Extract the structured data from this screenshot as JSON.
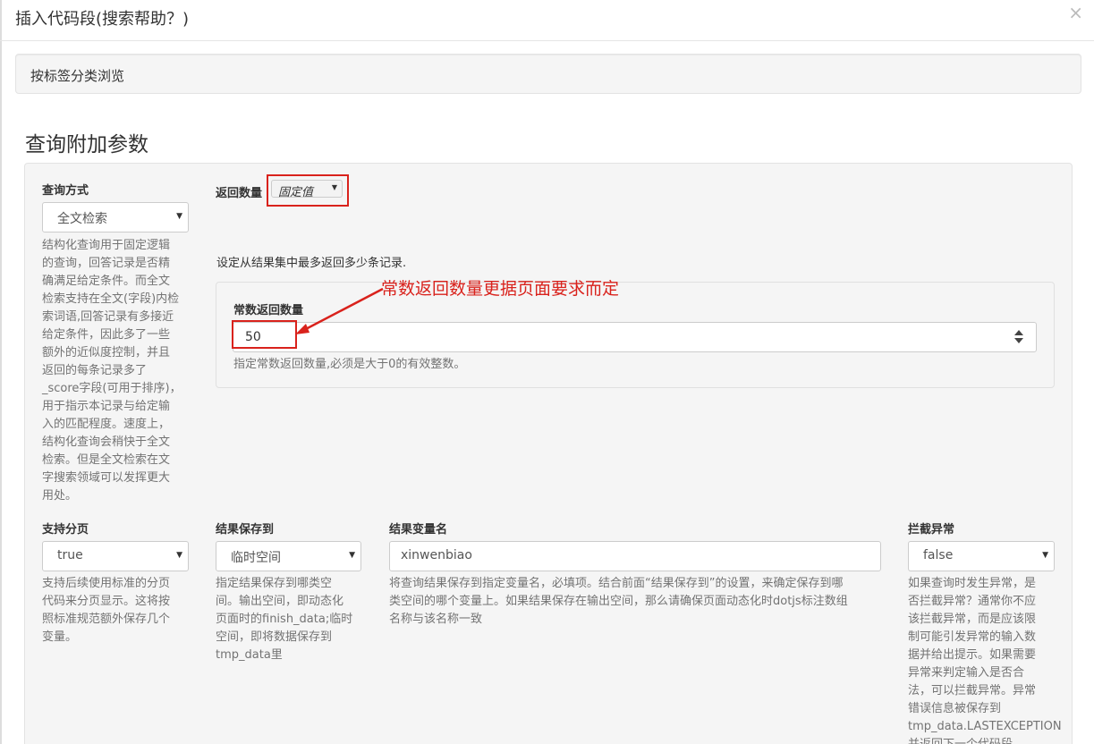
{
  "modal": {
    "title": "插入代码段(搜索帮助？)",
    "close": "×"
  },
  "tag_browse": "按标签分类浏览",
  "section_title": "查询附加参数",
  "query_method": {
    "label": "查询方式",
    "value": "全文检索",
    "help_lines": [
      "结构化查询用于固定逻辑",
      "的查询，回答记录是否精",
      "确满足给定条件。而全文",
      "检索支持在全文(字段)内检",
      "索词语,回答记录有多接近",
      "给定条件，因此多了一些",
      "额外的近似度控制，并且",
      "返回的每条记录多了",
      "_score字段(可用于排序)，",
      "用于指示本记录与给定输",
      "入的匹配程度。速度上，",
      "结构化查询会稍快于全文",
      "检索。但是全文检索在文",
      "字搜索领域可以发挥更大",
      "用处。"
    ]
  },
  "return_count": {
    "label": "返回数量",
    "mode": "固定值",
    "description": "设定从结果集中最多返回多少条记录.",
    "const_label": "常数返回数量",
    "const_value": "50",
    "const_help": "指定常数返回数量,必须是大于0的有效整数。"
  },
  "annotation": "常数返回数量更据页面要求而定",
  "paging": {
    "label": "支持分页",
    "value": "true",
    "help_lines": [
      "支持后续使用标准的分页",
      "代码来分页显示。这将按",
      "照标准规范额外保存几个",
      "变量。"
    ]
  },
  "save_to": {
    "label": "结果保存到",
    "value": "临时空间",
    "help_lines": [
      "指定结果保存到哪类空",
      "间。输出空间，即动态化",
      "页面时的finish_data;临时",
      "空间，即将数据保存到",
      "tmp_data里"
    ]
  },
  "var_name": {
    "label": "结果变量名",
    "value": "xinwenbiao",
    "help_lines": [
      "将查询结果保存到指定变量名，必填项。结合前面“结果保存到”的设置，来确定保存到哪",
      "类空间的哪个变量上。如果结果保存在输出空间，那么请确保页面动态化时dotjs标注数组",
      "名称与该名称一致"
    ]
  },
  "intercept": {
    "label": "拦截异常",
    "value": "false",
    "help_lines": [
      "如果查询时发生异常，是",
      "否拦截异常？通常你不应",
      "该拦截异常，而是应该限",
      "制可能引发异常的输入数",
      "据并给出提示。如果需要",
      "异常来判定输入是否合",
      "法，可以拦截异常。异常",
      "错误信息被保存到",
      "tmp_data.LASTEXCEPTION",
      "并返回下一个代码段"
    ]
  },
  "colors": {
    "annotation_red": "#d9221c",
    "well_bg": "#f5f5f5"
  }
}
